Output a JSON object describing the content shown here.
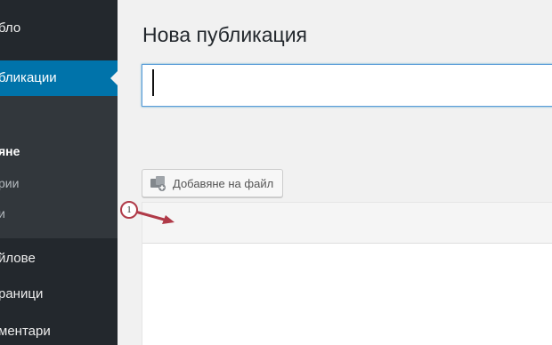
{
  "sidebar": {
    "dashboard_label": "бло",
    "posts_label": "бликации",
    "submenu": {
      "add_new_label": "яне",
      "categories_label": "рии",
      "tags_label": "и"
    },
    "media_label": "йлове",
    "pages_label": "раници",
    "comments_label": "ментари"
  },
  "main": {
    "page_title": "Нова публикация",
    "title_input": {
      "value": "",
      "placeholder": ""
    },
    "add_media_label": "Добавяне на файл"
  },
  "annotation": {
    "number": "1",
    "color": "#b03a48"
  },
  "colors": {
    "sidebar_bg": "#23282d",
    "submenu_bg": "#32373c",
    "active_item": "#0073aa",
    "input_focus": "#5b9dd9"
  }
}
